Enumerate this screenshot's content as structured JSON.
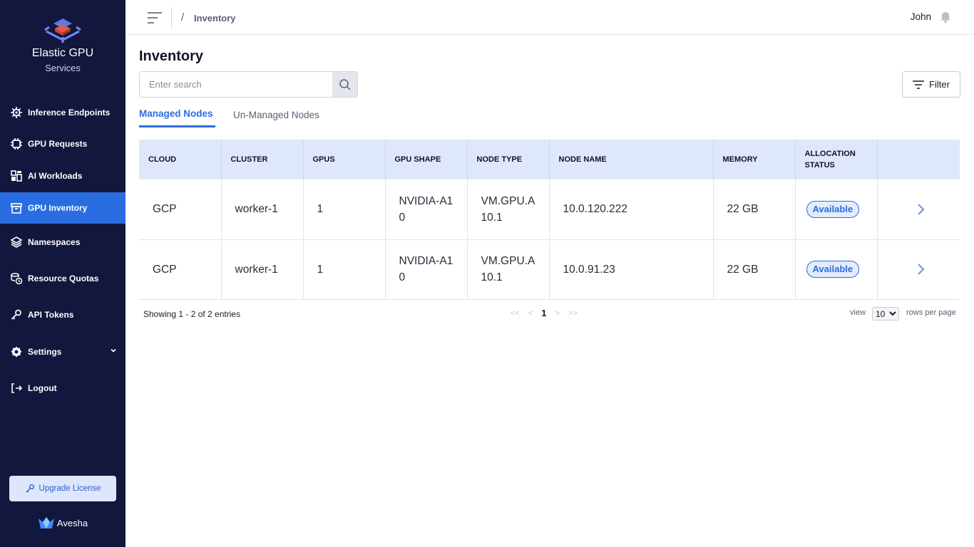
{
  "brand": {
    "title": "Elastic GPU",
    "subtitle": "Services"
  },
  "sidebar": {
    "items": [
      {
        "label": "Inference Endpoints",
        "icon": "gear-chip-icon"
      },
      {
        "label": "GPU Requests",
        "icon": "chip-icon"
      },
      {
        "label": "AI Workloads",
        "icon": "workloads-icon"
      },
      {
        "label": "GPU Inventory",
        "icon": "archive-box-icon",
        "active": true
      },
      {
        "label": "Namespaces",
        "icon": "layers-icon"
      },
      {
        "label": "Resource Quotas",
        "icon": "coins-clock-icon"
      },
      {
        "label": "API Tokens",
        "icon": "key-icon"
      },
      {
        "label": "Settings",
        "icon": "settings-icon",
        "expandable": true
      },
      {
        "label": "Logout",
        "icon": "logout-icon"
      }
    ],
    "upgrade_label": "Upgrade License",
    "footer_brand": "Avesha"
  },
  "header": {
    "breadcrumb_sep": "/",
    "breadcrumb": "Inventory",
    "user": "John"
  },
  "main": {
    "title": "Inventory",
    "search_placeholder": "Enter search",
    "filter_label": "Filter",
    "tabs": [
      {
        "label": "Managed Nodes",
        "active": true
      },
      {
        "label": "Un-Managed Nodes",
        "active": false
      }
    ]
  },
  "table": {
    "columns": [
      "CLOUD",
      "CLUSTER",
      "GPUS",
      "GPU SHAPE",
      "NODE TYPE",
      "NODE NAME",
      "MEMORY",
      "ALLOCATION STATUS"
    ],
    "rows": [
      {
        "cloud": "GCP",
        "cluster": "worker-1",
        "gpus": "1",
        "gpu_shape": "NVIDIA-A10",
        "node_type": "VM.GPU.A10.1",
        "node_name": "10.0.120.222",
        "memory": "22 GB",
        "status": "Available"
      },
      {
        "cloud": "GCP",
        "cluster": "worker-1",
        "gpus": "1",
        "gpu_shape": "NVIDIA-A10",
        "node_type": "VM.GPU.A10.1",
        "node_name": "10.0.91.23",
        "memory": "22 GB",
        "status": "Available"
      }
    ]
  },
  "pagination": {
    "summary": "Showing 1 - 2 of 2 entries",
    "first": "<<",
    "prev": "<",
    "current": "1",
    "next": ">",
    "last": ">>",
    "view_label": "view",
    "rows_value": "10",
    "rows_label": "rows per page"
  },
  "colors": {
    "sidebar_bg": "#13163d",
    "accent": "#2a6de0",
    "table_header_bg": "#dfe8fb"
  }
}
